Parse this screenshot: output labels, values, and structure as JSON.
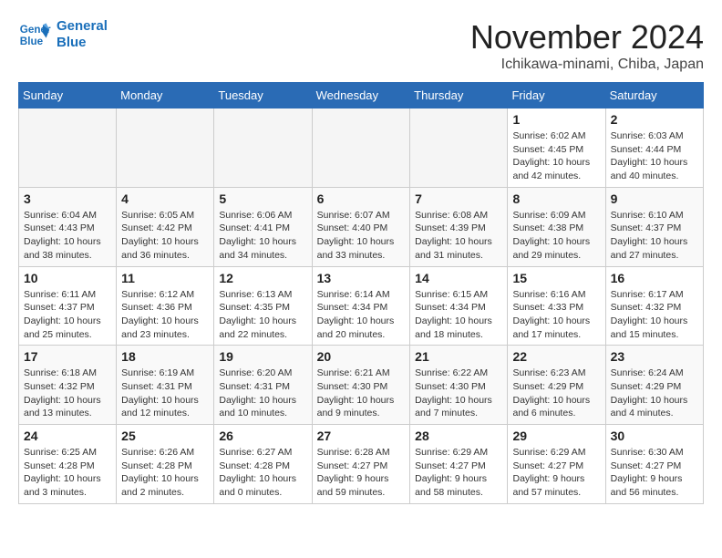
{
  "header": {
    "logo_line1": "General",
    "logo_line2": "Blue",
    "month": "November 2024",
    "location": "Ichikawa-minami, Chiba, Japan"
  },
  "weekdays": [
    "Sunday",
    "Monday",
    "Tuesday",
    "Wednesday",
    "Thursday",
    "Friday",
    "Saturday"
  ],
  "weeks": [
    [
      {
        "day": "",
        "info": ""
      },
      {
        "day": "",
        "info": ""
      },
      {
        "day": "",
        "info": ""
      },
      {
        "day": "",
        "info": ""
      },
      {
        "day": "",
        "info": ""
      },
      {
        "day": "1",
        "info": "Sunrise: 6:02 AM\nSunset: 4:45 PM\nDaylight: 10 hours and 42 minutes."
      },
      {
        "day": "2",
        "info": "Sunrise: 6:03 AM\nSunset: 4:44 PM\nDaylight: 10 hours and 40 minutes."
      }
    ],
    [
      {
        "day": "3",
        "info": "Sunrise: 6:04 AM\nSunset: 4:43 PM\nDaylight: 10 hours and 38 minutes."
      },
      {
        "day": "4",
        "info": "Sunrise: 6:05 AM\nSunset: 4:42 PM\nDaylight: 10 hours and 36 minutes."
      },
      {
        "day": "5",
        "info": "Sunrise: 6:06 AM\nSunset: 4:41 PM\nDaylight: 10 hours and 34 minutes."
      },
      {
        "day": "6",
        "info": "Sunrise: 6:07 AM\nSunset: 4:40 PM\nDaylight: 10 hours and 33 minutes."
      },
      {
        "day": "7",
        "info": "Sunrise: 6:08 AM\nSunset: 4:39 PM\nDaylight: 10 hours and 31 minutes."
      },
      {
        "day": "8",
        "info": "Sunrise: 6:09 AM\nSunset: 4:38 PM\nDaylight: 10 hours and 29 minutes."
      },
      {
        "day": "9",
        "info": "Sunrise: 6:10 AM\nSunset: 4:37 PM\nDaylight: 10 hours and 27 minutes."
      }
    ],
    [
      {
        "day": "10",
        "info": "Sunrise: 6:11 AM\nSunset: 4:37 PM\nDaylight: 10 hours and 25 minutes."
      },
      {
        "day": "11",
        "info": "Sunrise: 6:12 AM\nSunset: 4:36 PM\nDaylight: 10 hours and 23 minutes."
      },
      {
        "day": "12",
        "info": "Sunrise: 6:13 AM\nSunset: 4:35 PM\nDaylight: 10 hours and 22 minutes."
      },
      {
        "day": "13",
        "info": "Sunrise: 6:14 AM\nSunset: 4:34 PM\nDaylight: 10 hours and 20 minutes."
      },
      {
        "day": "14",
        "info": "Sunrise: 6:15 AM\nSunset: 4:34 PM\nDaylight: 10 hours and 18 minutes."
      },
      {
        "day": "15",
        "info": "Sunrise: 6:16 AM\nSunset: 4:33 PM\nDaylight: 10 hours and 17 minutes."
      },
      {
        "day": "16",
        "info": "Sunrise: 6:17 AM\nSunset: 4:32 PM\nDaylight: 10 hours and 15 minutes."
      }
    ],
    [
      {
        "day": "17",
        "info": "Sunrise: 6:18 AM\nSunset: 4:32 PM\nDaylight: 10 hours and 13 minutes."
      },
      {
        "day": "18",
        "info": "Sunrise: 6:19 AM\nSunset: 4:31 PM\nDaylight: 10 hours and 12 minutes."
      },
      {
        "day": "19",
        "info": "Sunrise: 6:20 AM\nSunset: 4:31 PM\nDaylight: 10 hours and 10 minutes."
      },
      {
        "day": "20",
        "info": "Sunrise: 6:21 AM\nSunset: 4:30 PM\nDaylight: 10 hours and 9 minutes."
      },
      {
        "day": "21",
        "info": "Sunrise: 6:22 AM\nSunset: 4:30 PM\nDaylight: 10 hours and 7 minutes."
      },
      {
        "day": "22",
        "info": "Sunrise: 6:23 AM\nSunset: 4:29 PM\nDaylight: 10 hours and 6 minutes."
      },
      {
        "day": "23",
        "info": "Sunrise: 6:24 AM\nSunset: 4:29 PM\nDaylight: 10 hours and 4 minutes."
      }
    ],
    [
      {
        "day": "24",
        "info": "Sunrise: 6:25 AM\nSunset: 4:28 PM\nDaylight: 10 hours and 3 minutes."
      },
      {
        "day": "25",
        "info": "Sunrise: 6:26 AM\nSunset: 4:28 PM\nDaylight: 10 hours and 2 minutes."
      },
      {
        "day": "26",
        "info": "Sunrise: 6:27 AM\nSunset: 4:28 PM\nDaylight: 10 hours and 0 minutes."
      },
      {
        "day": "27",
        "info": "Sunrise: 6:28 AM\nSunset: 4:27 PM\nDaylight: 9 hours and 59 minutes."
      },
      {
        "day": "28",
        "info": "Sunrise: 6:29 AM\nSunset: 4:27 PM\nDaylight: 9 hours and 58 minutes."
      },
      {
        "day": "29",
        "info": "Sunrise: 6:29 AM\nSunset: 4:27 PM\nDaylight: 9 hours and 57 minutes."
      },
      {
        "day": "30",
        "info": "Sunrise: 6:30 AM\nSunset: 4:27 PM\nDaylight: 9 hours and 56 minutes."
      }
    ]
  ]
}
